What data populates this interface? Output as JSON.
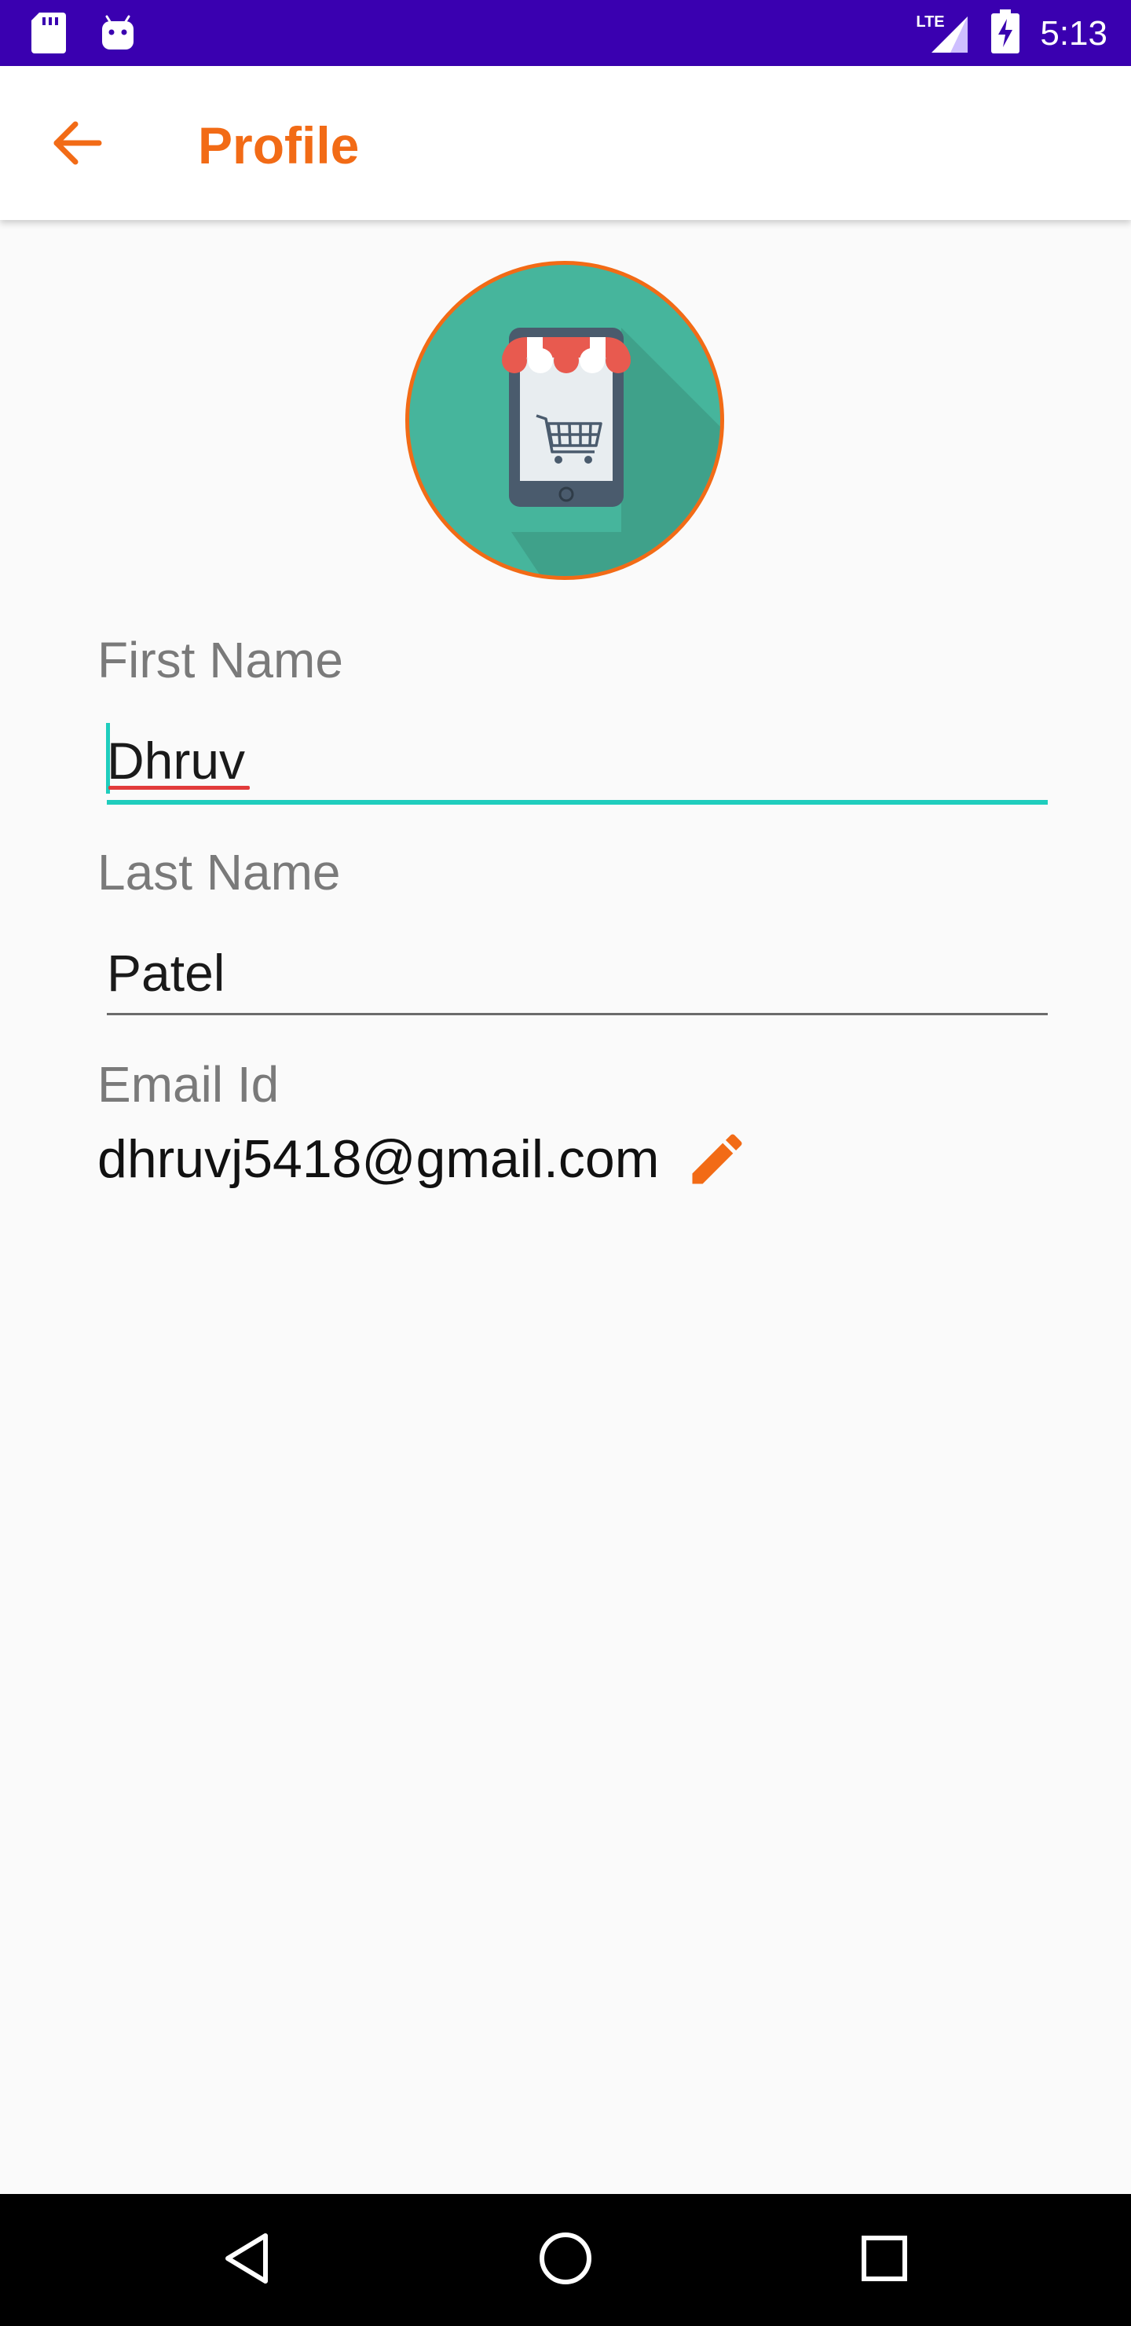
{
  "status_bar": {
    "time": "5:13",
    "network_label": "LTE",
    "icons": [
      "sd-card-icon",
      "android-icon",
      "signal-icon",
      "battery-charging-icon"
    ]
  },
  "app_bar": {
    "title": "Profile",
    "back_icon": "arrow-back-icon"
  },
  "colors": {
    "accent": "#f26b16",
    "status_bar": "#3a00b0",
    "field_active": "#1fcdbd",
    "avatar_bg": "#46b59c"
  },
  "profile": {
    "avatar_icon": "mobile-shop-cart-icon",
    "first_name": {
      "label": "First Name",
      "value": "Dhruv"
    },
    "last_name": {
      "label": "Last Name",
      "value": "Patel"
    },
    "email": {
      "label": "Email Id",
      "value": "dhruvj5418@gmail.com",
      "edit_icon": "pencil-icon"
    }
  },
  "nav_bar": {
    "buttons": [
      "back-triangle-icon",
      "home-circle-icon",
      "recents-square-icon"
    ]
  }
}
